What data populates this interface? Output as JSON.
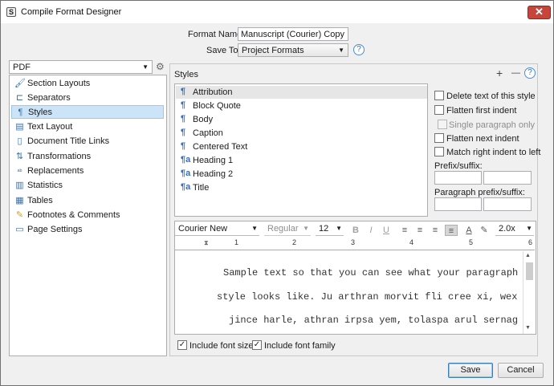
{
  "window": {
    "title": "Compile Format Designer",
    "icon_letter": "S",
    "close_glyph": "✕"
  },
  "header": {
    "format_name_label": "Format Name:",
    "format_name_value": "Manuscript (Courier) Copy",
    "save_to_label": "Save To:",
    "save_to_value": "Project Formats",
    "help_glyph": "?"
  },
  "sidebar": {
    "format_select": "PDF",
    "items": [
      {
        "label": "Section Layouts",
        "icon": "brush-icon",
        "glyph": "🖌",
        "selected": false
      },
      {
        "label": "Separators",
        "icon": "separator-icon",
        "glyph": "⊏",
        "selected": false
      },
      {
        "label": "Styles",
        "icon": "styles-icon",
        "glyph": "¶",
        "selected": true
      },
      {
        "label": "Text Layout",
        "icon": "text-layout-icon",
        "glyph": "▤",
        "selected": false
      },
      {
        "label": "Document Title Links",
        "icon": "document-icon",
        "glyph": "▯",
        "selected": false
      },
      {
        "label": "Transformations",
        "icon": "transform-icon",
        "glyph": "⇅",
        "selected": false
      },
      {
        "label": "Replacements",
        "icon": "replacements-icon",
        "glyph": "ᵃᵇ",
        "selected": false
      },
      {
        "label": "Statistics",
        "icon": "statistics-icon",
        "glyph": "▥",
        "selected": false
      },
      {
        "label": "Tables",
        "icon": "table-icon",
        "glyph": "▦",
        "selected": false
      },
      {
        "label": "Footnotes & Comments",
        "icon": "footnote-icon",
        "glyph": "✎",
        "selected": false
      },
      {
        "label": "Page Settings",
        "icon": "page-settings-icon",
        "glyph": "▭",
        "selected": false
      }
    ]
  },
  "styles": {
    "heading": "Styles",
    "add_glyph": "+",
    "remove_glyph": "—",
    "help_glyph": "?",
    "items": [
      {
        "label": "Attribution",
        "glyph": "¶",
        "selected": true
      },
      {
        "label": "Block Quote",
        "glyph": "¶",
        "selected": false
      },
      {
        "label": "Body",
        "glyph": "¶",
        "selected": false
      },
      {
        "label": "Caption",
        "glyph": "¶",
        "selected": false
      },
      {
        "label": "Centered Text",
        "glyph": "¶",
        "selected": false
      },
      {
        "label": "Heading 1",
        "glyph": "¶a",
        "selected": false
      },
      {
        "label": "Heading 2",
        "glyph": "¶a",
        "selected": false
      },
      {
        "label": "Title",
        "glyph": "¶a",
        "selected": false
      }
    ],
    "options": {
      "delete_text": "Delete text of this style",
      "flatten_first": "Flatten first indent",
      "single_paragraph": "Single paragraph only",
      "flatten_next": "Flatten next indent",
      "match_right_indent": "Match right indent to left",
      "prefix_suffix_label": "Prefix/suffix:",
      "paragraph_prefix_suffix_label": "Paragraph prefix/suffix:"
    }
  },
  "format_bar": {
    "font": "Courier New",
    "weight": "Regular",
    "size": "12",
    "line_spacing": "2.0x",
    "bold": "B",
    "italic": "I",
    "underline": "U"
  },
  "ruler": {
    "numbers": [
      "1",
      "2",
      "3",
      "4",
      "5",
      "6"
    ]
  },
  "sample_text": {
    "lines": [
      "Sample text so that you can see what your paragraph",
      "style looks like. Ju arthran morvit fli cree xi, wex",
      "jince harle, athran irpsa yem, tolaspa arul sernag"
    ]
  },
  "footer_options": {
    "include_font_size": "Include font size",
    "include_font_family": "Include font family"
  },
  "buttons": {
    "save": "Save",
    "cancel": "Cancel"
  }
}
